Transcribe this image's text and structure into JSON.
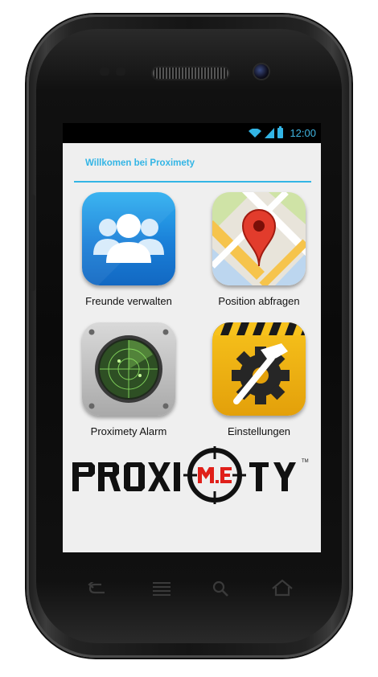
{
  "status_bar": {
    "time": "12:00",
    "icons": [
      "wifi-icon",
      "signal-icon",
      "battery-icon"
    ]
  },
  "header": {
    "welcome_text": "Willkomen bei Proximety"
  },
  "tiles": [
    {
      "label": "Freunde verwalten",
      "icon": "friends-icon"
    },
    {
      "label": "Position abfragen",
      "icon": "map-pin-icon"
    },
    {
      "label": "Proximety Alarm",
      "icon": "radar-icon"
    },
    {
      "label": "Einstellungen",
      "icon": "settings-gear-icon"
    }
  ],
  "logo": {
    "left": "PROXI",
    "center": "M.E",
    "right": "TY"
  },
  "nav_keys": [
    "back-icon",
    "menu-icon",
    "search-icon",
    "home-icon"
  ],
  "colors": {
    "accent": "#33b5e5",
    "screen_bg": "#efefef",
    "logo_red": "#e0201a"
  }
}
